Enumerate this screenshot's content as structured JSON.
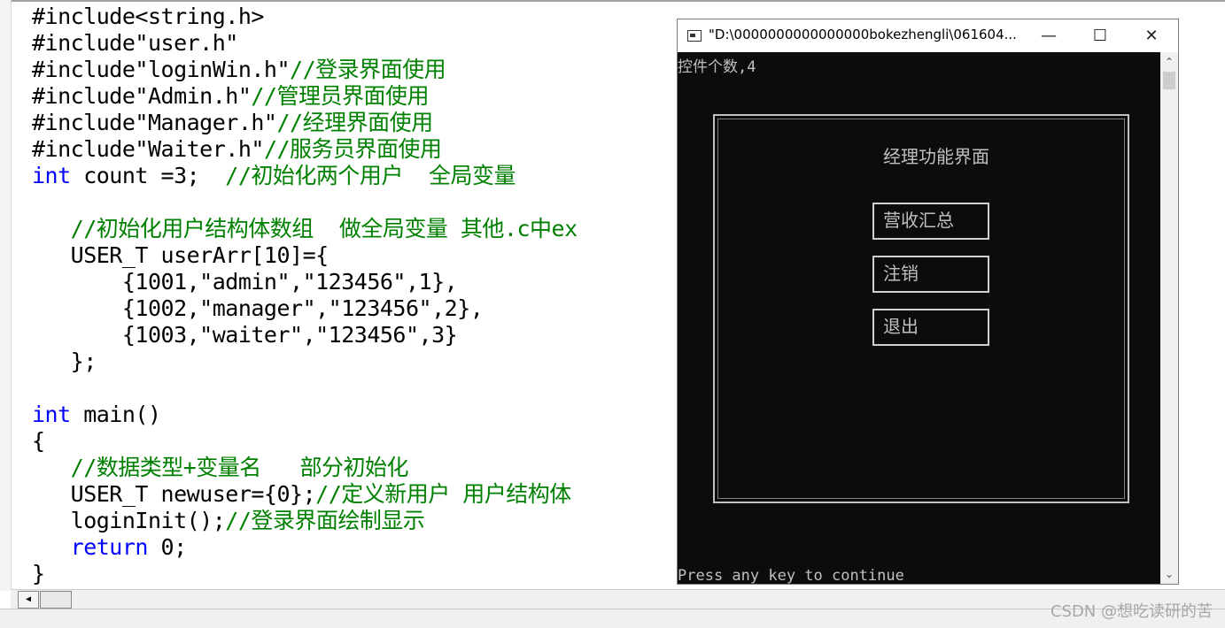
{
  "editor": {
    "lines": [
      {
        "code": "#include<string.h>",
        "comment": ""
      },
      {
        "code": "#include\"user.h\"",
        "comment": ""
      },
      {
        "code": "#include\"loginWin.h\"",
        "comment": "//登录界面使用"
      },
      {
        "code": "#include\"Admin.h\"",
        "comment": "//管理员界面使用"
      },
      {
        "code": "#include\"Manager.h\"",
        "comment": "//经理界面使用"
      },
      {
        "code": "#include\"Waiter.h\"",
        "comment": "//服务员界面使用"
      },
      {
        "kw": "int",
        "code": " count =3;  ",
        "comment": "//初始化两个用户  全局变量"
      },
      {
        "code": "",
        "comment": ""
      },
      {
        "code": "   ",
        "comment": "//初始化用户结构体数组  做全局变量 其他.c中ex"
      },
      {
        "code": "   USER_T userArr[10]={",
        "comment": ""
      },
      {
        "code": "       {1001,\"admin\",\"123456\",1},",
        "comment": ""
      },
      {
        "code": "       {1002,\"manager\",\"123456\",2},",
        "comment": ""
      },
      {
        "code": "       {1003,\"waiter\",\"123456\",3}",
        "comment": ""
      },
      {
        "code": "   };",
        "comment": ""
      },
      {
        "code": "",
        "comment": ""
      },
      {
        "kw": "int",
        "code": " main()",
        "comment": ""
      },
      {
        "code": "{",
        "comment": ""
      },
      {
        "code": "   ",
        "comment": "//数据类型+变量名   部分初始化"
      },
      {
        "code": "   USER_T newuser={0};",
        "comment": "//定义新用户 用户结构体"
      },
      {
        "code": "   loginInit();",
        "comment": "//登录界面绘制显示"
      },
      {
        "kw2": "return",
        "code": " 0;",
        "comment": ""
      },
      {
        "code": "}",
        "comment": ""
      }
    ]
  },
  "console": {
    "title": "\"D:\\0000000000000000bokezhengli\\061604...",
    "minimize": "—",
    "maximize": "☐",
    "close": "✕",
    "count_line": "控件个数,4",
    "panel_title": "经理功能界面",
    "buttons": [
      "营收汇总",
      "注销",
      "退出"
    ],
    "press_line": "Press any key to continue"
  },
  "watermark": "CSDN @想吃读研的苦"
}
